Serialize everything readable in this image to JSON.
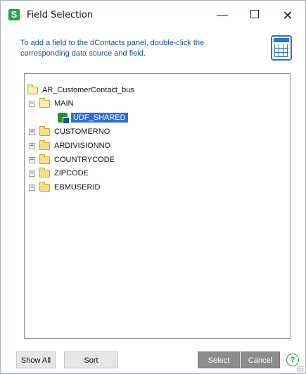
{
  "window": {
    "title": "Field Selection",
    "controls": {
      "minimize": "—",
      "close": "✕"
    }
  },
  "instructions": "To add a field to the dContacts panel, double-click the corresponding data source and field.",
  "tree": {
    "root": "AR_CustomerContact_bus",
    "main": {
      "expander": "−",
      "label": "MAIN"
    },
    "selected_field": "UDF_SHARED",
    "nodes": [
      {
        "expander": "+",
        "label": "CUSTOMERNO"
      },
      {
        "expander": "+",
        "label": "ARDIVISIONNO"
      },
      {
        "expander": "+",
        "label": "COUNTRYCODE"
      },
      {
        "expander": "+",
        "label": "ZIPCODE"
      },
      {
        "expander": "+",
        "label": "EBMUSERID"
      }
    ]
  },
  "buttons": {
    "show_all": "Show All",
    "sort": "Sort",
    "select": "Select",
    "cancel": "Cancel",
    "help": "?"
  },
  "colors": {
    "accent": "#2f6fcf",
    "app_icon": "#18a84a",
    "instructions_text": "#1c4f8c"
  },
  "icons": {
    "app": "sage-s-icon",
    "grid": "table-grid-icon",
    "folder": "folder-icon",
    "open_folder": "open-folder-icon",
    "field": "data-field-icon",
    "help": "help-circle-icon"
  }
}
